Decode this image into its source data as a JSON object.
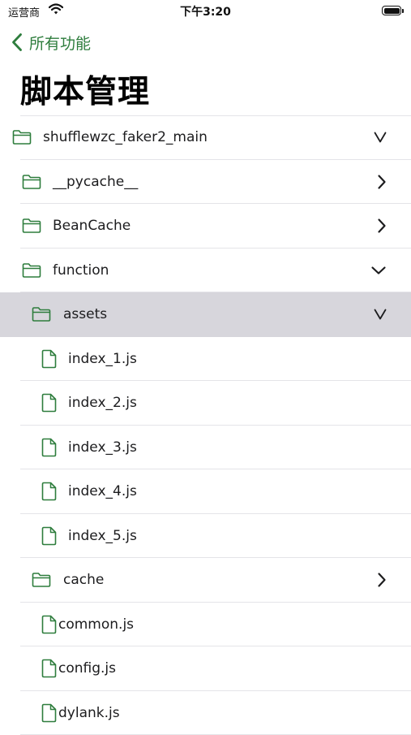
{
  "status_bar": {
    "carrier": "运营商",
    "time": "下午3:20"
  },
  "nav": {
    "back_label": "所有功能"
  },
  "page": {
    "title": "脚本管理"
  },
  "colors": {
    "accent": "#2e7d3d",
    "selected_row": "#d7d6dc"
  },
  "tree": [
    {
      "name": "shufflewzc_faker2_main",
      "kind": "folder",
      "depth": 0,
      "state": "expanded",
      "chevron": "down-v-icon"
    },
    {
      "name": "__pycache__",
      "kind": "folder",
      "depth": 1,
      "state": "collapsed",
      "chevron": "chevron-right-icon"
    },
    {
      "name": "BeanCache",
      "kind": "folder",
      "depth": 1,
      "state": "collapsed",
      "chevron": "chevron-right-icon"
    },
    {
      "name": "function",
      "kind": "folder",
      "depth": 1,
      "state": "expanded",
      "chevron": "chevron-down-icon"
    },
    {
      "name": "assets",
      "kind": "folder",
      "depth": 2,
      "state": "expanded",
      "selected": true,
      "chevron": "down-v-icon"
    },
    {
      "name": "index_1.js",
      "kind": "file",
      "depth": 3
    },
    {
      "name": "index_2.js",
      "kind": "file",
      "depth": 3
    },
    {
      "name": "index_3.js",
      "kind": "file",
      "depth": 3
    },
    {
      "name": "index_4.js",
      "kind": "file",
      "depth": 3
    },
    {
      "name": "index_5.js",
      "kind": "file",
      "depth": 3
    },
    {
      "name": "cache",
      "kind": "folder",
      "depth": 2,
      "state": "collapsed",
      "chevron": "chevron-right-icon"
    },
    {
      "name": "common.js",
      "kind": "file",
      "depth": 1
    },
    {
      "name": "config.js",
      "kind": "file",
      "depth": 1
    },
    {
      "name": "dylank.js",
      "kind": "file",
      "depth": 1
    }
  ]
}
